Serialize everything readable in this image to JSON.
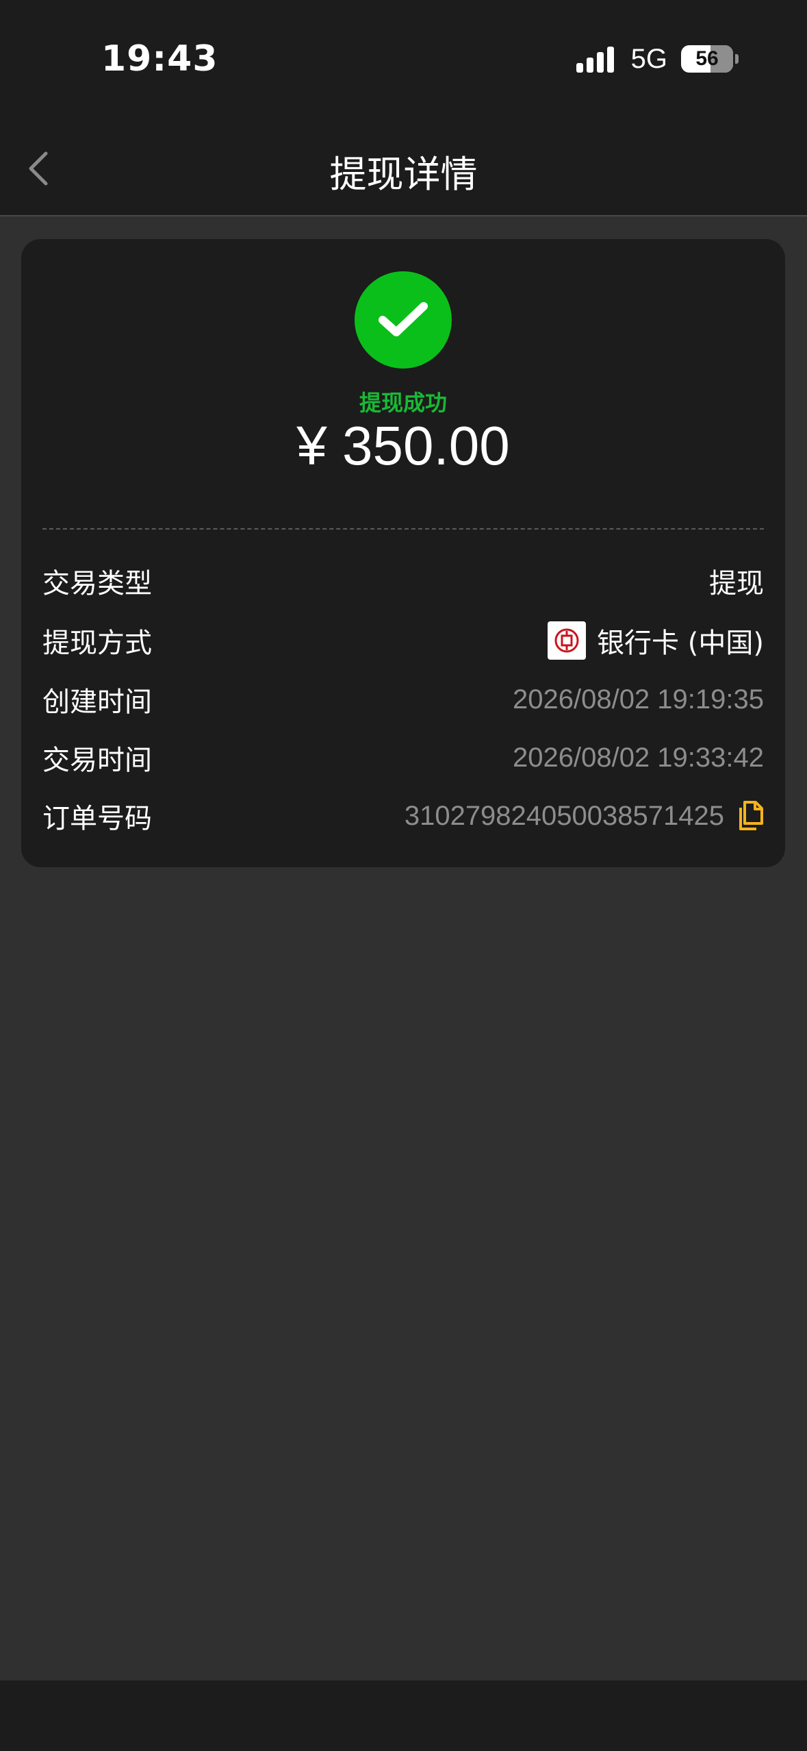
{
  "status_bar": {
    "time": "19:43",
    "network": "5G",
    "battery": "56"
  },
  "header": {
    "title": "提现详情",
    "back_icon": "chevron-left-icon"
  },
  "summary": {
    "status_icon": "check-circle-icon",
    "status_color": "#0bbf1a",
    "status_text": "提现成功",
    "amount": "¥ 350.00"
  },
  "details": {
    "rows": [
      {
        "label": "交易类型",
        "value": "提现"
      },
      {
        "label": "提现方式",
        "value": "银行卡 (中国)",
        "icon": "bank-logo-icon"
      },
      {
        "label": "创建时间",
        "value": "2026/08/02 19:19:35"
      },
      {
        "label": "交易时间",
        "value": "2026/08/02 19:33:42"
      },
      {
        "label": "订单号码",
        "value": "310279824050038571425",
        "action_icon": "copy-icon"
      }
    ]
  },
  "colors": {
    "accent": "#f5b419",
    "success": "#19b935",
    "bank_red": "#c8141e"
  }
}
